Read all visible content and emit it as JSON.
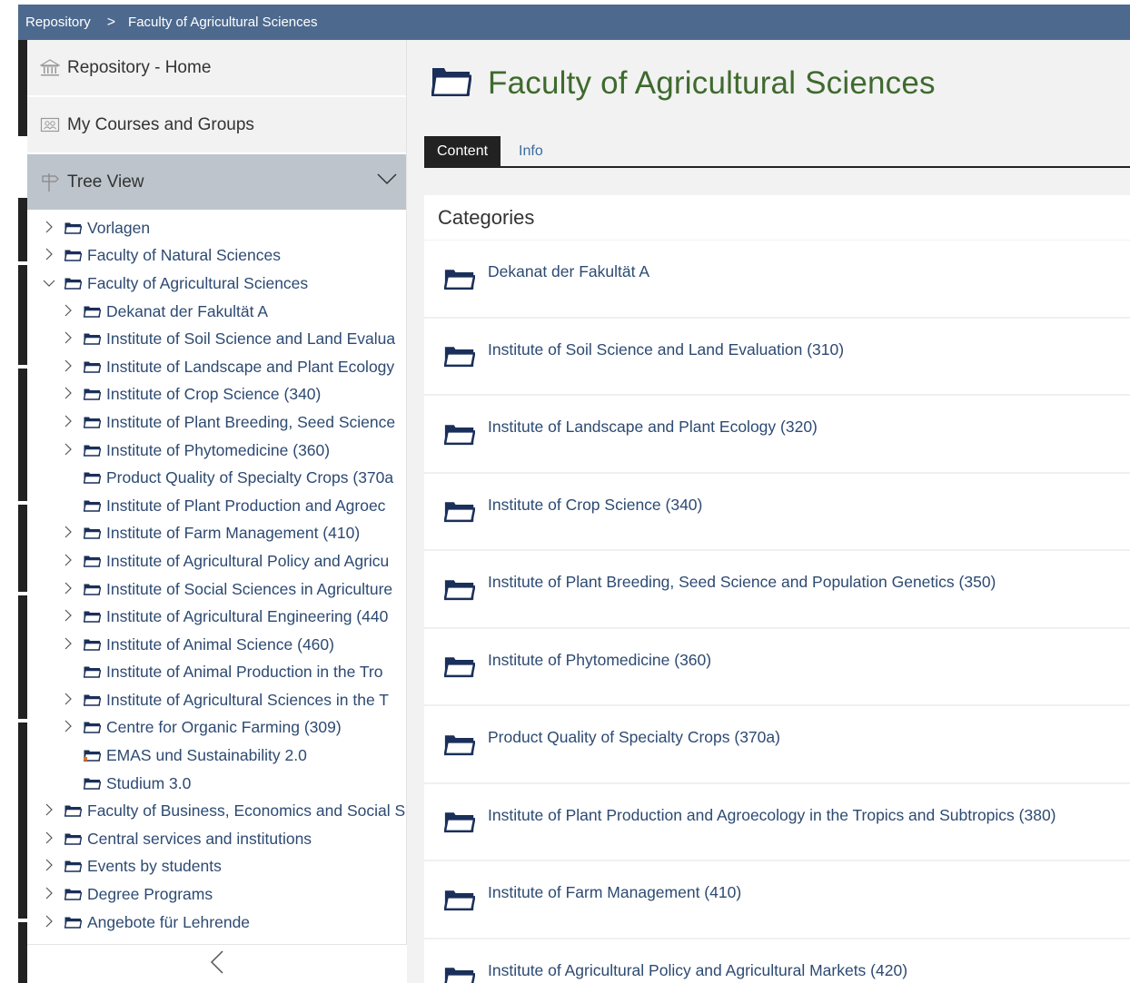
{
  "breadcrumb": {
    "root": "Repository",
    "separator": ">",
    "current": "Faculty of Agricultural Sciences"
  },
  "sidebar": {
    "home": "Repository - Home",
    "courses": "My Courses and Groups",
    "tree_view": "Tree View",
    "tree": [
      {
        "label": "Vorlagen",
        "level": 0,
        "state": "collapsed"
      },
      {
        "label": "Faculty of Natural Sciences",
        "level": 0,
        "state": "collapsed"
      },
      {
        "label": "Faculty of Agricultural Sciences",
        "level": 0,
        "state": "expanded"
      },
      {
        "label": "Dekanat der Fakultät A",
        "level": 1,
        "state": "collapsed"
      },
      {
        "label": "Institute of Soil Science and Land Evalua",
        "level": 1,
        "state": "collapsed"
      },
      {
        "label": "Institute of Landscape and Plant Ecology",
        "level": 1,
        "state": "collapsed"
      },
      {
        "label": "Institute of Crop Science (340)",
        "level": 1,
        "state": "collapsed"
      },
      {
        "label": "Institute of Plant Breeding, Seed Science",
        "level": 1,
        "state": "collapsed"
      },
      {
        "label": "Institute of Phytomedicine (360)",
        "level": 1,
        "state": "collapsed"
      },
      {
        "label": "Product Quality of Specialty Crops (370a",
        "level": 1,
        "state": "leaf"
      },
      {
        "label": "Institute of Plant Production and Agroec",
        "level": 1,
        "state": "leaf"
      },
      {
        "label": "Institute of Farm Management (410)",
        "level": 1,
        "state": "collapsed"
      },
      {
        "label": "Institute of Agricultural Policy and Agricu",
        "level": 1,
        "state": "collapsed"
      },
      {
        "label": "Institute of Social Sciences in Agriculture",
        "level": 1,
        "state": "collapsed"
      },
      {
        "label": "Institute of Agricultural Engineering (440",
        "level": 1,
        "state": "collapsed"
      },
      {
        "label": "Institute of Animal Science (460)",
        "level": 1,
        "state": "collapsed"
      },
      {
        "label": "Institute of Animal Production in the Tro",
        "level": 1,
        "state": "leaf"
      },
      {
        "label": "Institute of Agricultural Sciences in the T",
        "level": 1,
        "state": "collapsed"
      },
      {
        "label": "Centre for Organic Farming (309)",
        "level": 1,
        "state": "collapsed"
      },
      {
        "label": "EMAS und Sustainability 2.0",
        "level": 1,
        "state": "leaf",
        "special": true
      },
      {
        "label": "Studium 3.0",
        "level": 1,
        "state": "leaf"
      },
      {
        "label": "Faculty of Business, Economics and Social S",
        "level": 0,
        "state": "collapsed"
      },
      {
        "label": "Central services and institutions",
        "level": 0,
        "state": "collapsed"
      },
      {
        "label": "Events by students",
        "level": 0,
        "state": "collapsed"
      },
      {
        "label": "Degree Programs",
        "level": 0,
        "state": "collapsed"
      },
      {
        "label": "Angebote für Lehrende",
        "level": 0,
        "state": "collapsed"
      }
    ]
  },
  "main": {
    "title": "Faculty of Agricultural Sciences",
    "tabs": [
      "Content",
      "Info"
    ],
    "active_tab": "Content",
    "panel_title": "Categories",
    "categories": [
      "Dekanat der Fakultät A",
      "Institute of Soil Science and Land Evaluation (310)",
      "Institute of Landscape and Plant Ecology (320)",
      "Institute of Crop Science (340)",
      "Institute of Plant Breeding, Seed Science and Population Genetics (350)",
      "Institute of Phytomedicine (360)",
      "Product Quality of Specialty Crops (370a)",
      "Institute of Plant Production and Agroecology in the Tropics and Subtropics (380)",
      "Institute of Farm Management (410)",
      "Institute of Agricultural Policy and Agricultural Markets (420)"
    ]
  },
  "colors": {
    "topbar": "#4d6a8e",
    "title_green": "#3f6a2e",
    "link_blue": "#2d4a72",
    "folder_navy": "#1a2f5a",
    "tree_view_bg": "#bdc4cc"
  }
}
